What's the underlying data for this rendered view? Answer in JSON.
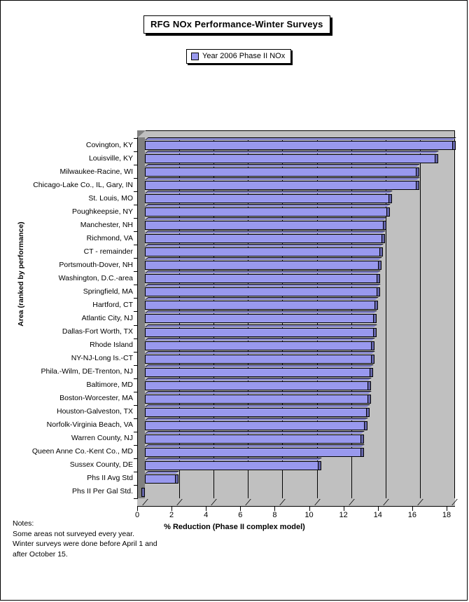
{
  "title": "RFG NOx Performance-Winter Surveys",
  "legend": {
    "entries": [
      {
        "label": "Year 2006 Phase II NOx",
        "color": "#9999ee"
      }
    ]
  },
  "axes": {
    "x_title": "% Reduction (Phase II complex model)",
    "y_title": "Area (ranked by performance)"
  },
  "notes": {
    "heading": "Notes:",
    "line1": "Some areas not surveyed every year.",
    "line2": "Winter surveys were done before April 1 and",
    "line3": "after October 15."
  },
  "chart_data": {
    "type": "bar",
    "orientation": "horizontal",
    "title": "RFG NOx Performance-Winter Surveys",
    "xlabel": "% Reduction (Phase II complex model)",
    "ylabel": "Area (ranked by performance)",
    "xlim": [
      0,
      18
    ],
    "xticks": [
      0,
      2,
      4,
      6,
      8,
      10,
      12,
      14,
      16,
      18
    ],
    "grid": true,
    "legend_position": "top",
    "series_name": "Year 2006 Phase II NOx",
    "bar_color": "#9999ee",
    "categories": [
      "Covington, KY",
      "Louisville, KY",
      "Milwaukee-Racine, WI",
      "Chicago-Lake Co., IL, Gary, IN",
      "St. Louis, MO",
      "Poughkeepsie, NY",
      "Manchester, NH",
      "Richmond, VA",
      "CT - remainder",
      "Portsmouth-Dover, NH",
      "Washington, D.C.-area",
      "Springfield, MA",
      "Hartford, CT",
      "Atlantic City, NJ",
      "Dallas-Fort Worth, TX",
      "Rhode Island",
      "NY-NJ-Long Is.-CT",
      "Phila.-Wilm, DE-Trenton, NJ",
      "Baltimore, MD",
      "Boston-Worcester, MA",
      "Houston-Galveston, TX",
      "Norfolk-Virginia Beach, VA",
      "Warren County, NJ",
      "Queen Anne Co.-Kent Co., MD",
      "Sussex County, DE",
      "Phs II Avg Std",
      "Phs II Per Gal Std."
    ],
    "values": [
      17.9,
      16.9,
      15.8,
      15.8,
      14.2,
      14.1,
      13.9,
      13.8,
      13.7,
      13.6,
      13.5,
      13.5,
      13.4,
      13.3,
      13.3,
      13.2,
      13.2,
      13.1,
      13.0,
      13.0,
      12.9,
      12.8,
      12.6,
      12.6,
      10.1,
      1.8,
      0.0
    ]
  }
}
